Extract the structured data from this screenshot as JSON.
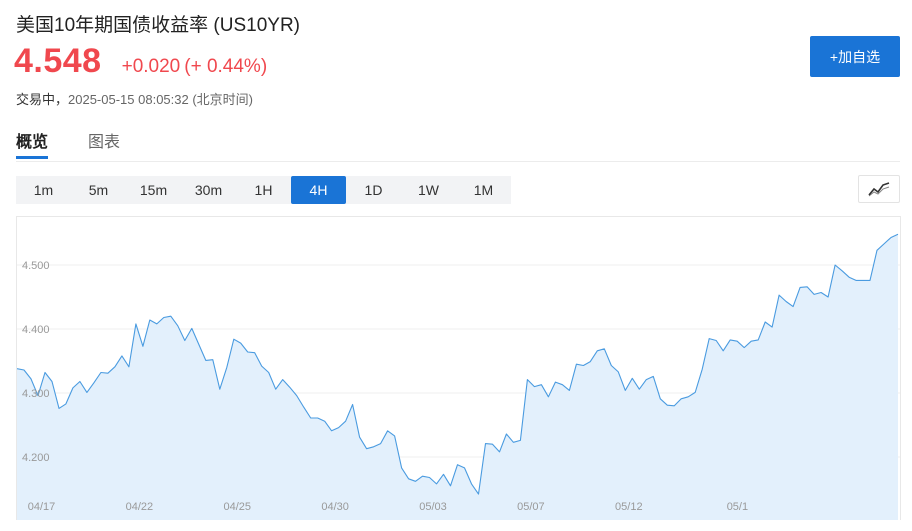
{
  "header": {
    "title": "美国10年期国债收益率  (US10YR)",
    "price": "4.548",
    "change": "+0.020",
    "change_pct": "(+ 0.44%)",
    "status": "交易中，",
    "timestamp": "2025-05-15 08:05:32 (北京时间)",
    "add_button": "+加自选"
  },
  "tabs": [
    {
      "label": "概览",
      "active": true
    },
    {
      "label": "图表",
      "active": false
    }
  ],
  "periods": [
    {
      "label": "1m",
      "active": false
    },
    {
      "label": "5m",
      "active": false
    },
    {
      "label": "15m",
      "active": false
    },
    {
      "label": "30m",
      "active": false
    },
    {
      "label": "1H",
      "active": false
    },
    {
      "label": "4H",
      "active": true
    },
    {
      "label": "1D",
      "active": false
    },
    {
      "label": "1W",
      "active": false
    },
    {
      "label": "1M",
      "active": false
    }
  ],
  "chart_toggle_icon": "line-chart-icon",
  "colors": {
    "accent": "#1a74d6",
    "up": "#f0484e",
    "line": "#4a9be0",
    "area": "#e3f0fc"
  },
  "chart_data": {
    "type": "area",
    "title": "",
    "xlabel": "",
    "ylabel": "",
    "ylim": [
      4.12,
      4.58
    ],
    "yticks": [
      "4.200",
      "4.300",
      "4.400",
      "4.500"
    ],
    "xticks": [
      "04/17",
      "04/22",
      "04/25",
      "04/30",
      "05/03",
      "05/07",
      "05/12",
      "05/1"
    ],
    "x_tick_positions": [
      3.5,
      17.5,
      31.5,
      45.5,
      59.5,
      73.5,
      87.5,
      101.5
    ],
    "grid": true,
    "series": [
      {
        "values": [
          4.338,
          4.336,
          4.322,
          4.296,
          4.332,
          4.318,
          4.276,
          4.283,
          4.308,
          4.318,
          4.301,
          4.316,
          4.332,
          4.331,
          4.341,
          4.358,
          4.341,
          4.408,
          4.373,
          4.414,
          4.408,
          4.418,
          4.42,
          4.405,
          4.382,
          4.401,
          4.376,
          4.351,
          4.352,
          4.306,
          4.34,
          4.384,
          4.378,
          4.364,
          4.363,
          4.342,
          4.332,
          4.306,
          4.321,
          4.309,
          4.296,
          4.278,
          4.261,
          4.261,
          4.256,
          4.241,
          4.246,
          4.256,
          4.282,
          4.231,
          4.213,
          4.216,
          4.221,
          4.241,
          4.233,
          4.183,
          4.166,
          4.162,
          4.17,
          4.168,
          4.158,
          4.173,
          4.155,
          4.188,
          4.183,
          4.158,
          4.142,
          4.221,
          4.22,
          4.208,
          4.236,
          4.223,
          4.226,
          4.321,
          4.31,
          4.313,
          4.294,
          4.317,
          4.313,
          4.304,
          4.345,
          4.343,
          4.349,
          4.366,
          4.369,
          4.343,
          4.333,
          4.304,
          4.323,
          4.306,
          4.321,
          4.326,
          4.291,
          4.281,
          4.28,
          4.291,
          4.294,
          4.301,
          4.337,
          4.385,
          4.382,
          4.366,
          4.383,
          4.381,
          4.371,
          4.381,
          4.383,
          4.411,
          4.403,
          4.453,
          4.443,
          4.435,
          4.465,
          4.466,
          4.454,
          4.457,
          4.45,
          4.5,
          4.491,
          4.481,
          4.476,
          4.476,
          4.476,
          4.523,
          4.533,
          4.543,
          4.548
        ]
      }
    ]
  }
}
